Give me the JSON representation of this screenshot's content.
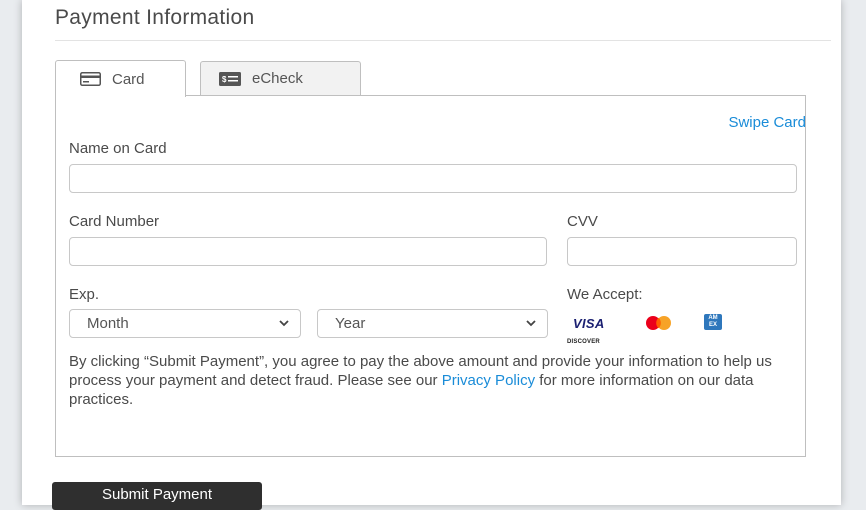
{
  "page": {
    "title": "Payment Information"
  },
  "tabs": [
    {
      "label": "Card",
      "icon": "credit-card-icon",
      "active": true
    },
    {
      "label": "eCheck",
      "icon": "check-icon",
      "active": false
    }
  ],
  "form": {
    "swipe_card": "Swipe Card",
    "name_on_card": {
      "label": "Name on Card",
      "value": "",
      "placeholder": ""
    },
    "card_number": {
      "label": "Card Number",
      "value": "",
      "placeholder": ""
    },
    "cvv": {
      "label": "CVV",
      "value": "",
      "placeholder": ""
    },
    "exp_label": "Exp.",
    "month": {
      "selected": "Month"
    },
    "year": {
      "selected": "Year"
    },
    "we_accept_label": "We Accept:",
    "accepted_cards": {
      "visa": "VISA",
      "mastercard": "mastercard-logo",
      "amex": "AM EX",
      "discover": "DISCOVER"
    }
  },
  "consent": {
    "text_before": "By clicking “Submit Payment”, you agree to pay the above amount and provide your information to help us process your payment and detect fraud. Please see our ",
    "privacy_link": "Privacy Policy",
    "text_after": " for more information on our data practices."
  },
  "submit_button": "Submit Payment",
  "colors": {
    "link": "#1a8cd8",
    "button_bg": "#2f2f2f",
    "visa": "#1a1f71",
    "amex": "#2e77bc",
    "mc_red": "#eb001b",
    "mc_orange": "#f79e1b"
  }
}
